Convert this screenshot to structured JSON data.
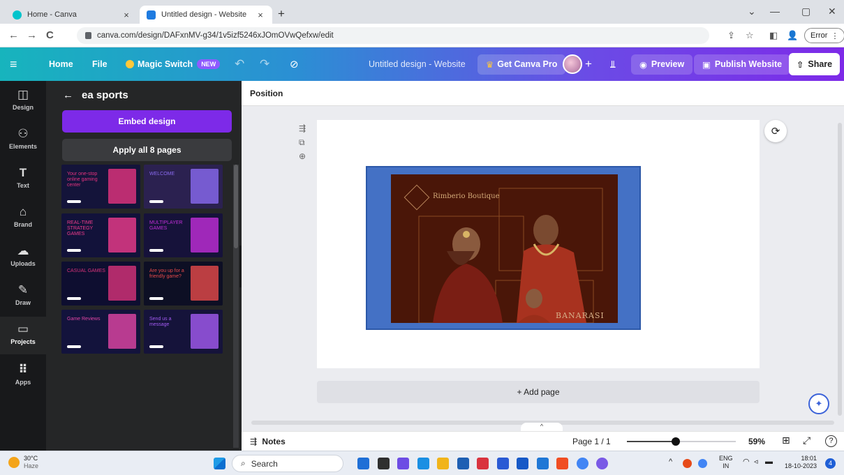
{
  "browser": {
    "tabs": [
      {
        "title": "Home - Canva",
        "close": "×"
      },
      {
        "title": "Untitled design - Website",
        "close": "×"
      }
    ],
    "new_tab": "+",
    "window_controls": {
      "menu": "⌄",
      "minimize": "—",
      "restore": "▢",
      "close": "✕"
    },
    "nav": {
      "back": "←",
      "forward": "→",
      "reload": "C"
    },
    "url": "canva.com/design/DAFxnMV-g34/1v5izf5246xJOmOVwQefxw/edit",
    "addr_icons": {
      "share": "⇪",
      "star": "☆",
      "sidebar": "◧",
      "profile": "👤"
    },
    "error_label": "Error",
    "error_menu": "⋮"
  },
  "toolbar": {
    "menu_icon": "≡",
    "home": "Home",
    "file": "File",
    "magic_switch": "Magic Switch",
    "new_badge": "NEW",
    "undo": "↶",
    "redo": "↷",
    "saved_icon": "⊘",
    "doc_title": "Untitled design - Website",
    "get_pro": "Get Canva Pro",
    "crown": "♛",
    "plus": "+",
    "insights_icon": "⫫",
    "preview": "Preview",
    "preview_icon": "◉",
    "publish": "Publish Website",
    "publish_icon": "▣",
    "share": "Share",
    "share_icon": "⇧"
  },
  "rail": [
    {
      "label": "Design",
      "glyph": "◫"
    },
    {
      "label": "Elements",
      "glyph": "⚇"
    },
    {
      "label": "Text",
      "glyph": "T"
    },
    {
      "label": "Brand",
      "glyph": "⌂"
    },
    {
      "label": "Uploads",
      "glyph": "☁"
    },
    {
      "label": "Draw",
      "glyph": "✎"
    },
    {
      "label": "Projects",
      "glyph": "▭"
    },
    {
      "label": "Apps",
      "glyph": "⠿"
    }
  ],
  "panel": {
    "back": "←",
    "title": "ea sports",
    "embed_button": "Embed design",
    "apply_button": "Apply all 8 pages",
    "thumbs": [
      {
        "headline": "Your one-stop online gaming center",
        "bg": "#14143a",
        "accent": "#e5337f"
      },
      {
        "headline": "WELCOME",
        "bg": "#2b2150",
        "accent": "#8a6af0"
      },
      {
        "headline": "REAL-TIME STRATEGY GAMES",
        "bg": "#12123a",
        "accent": "#ef3c8c"
      },
      {
        "headline": "MULTIPLAYER GAMES",
        "bg": "#16123a",
        "accent": "#c22ed9"
      },
      {
        "headline": "CASUAL GAMES",
        "bg": "#0e0e30",
        "accent": "#d9337a"
      },
      {
        "headline": "Are you up for a friendly game?",
        "bg": "#0d0f24",
        "accent": "#e74a4a"
      },
      {
        "headline": "Game Reviews",
        "bg": "#13133c",
        "accent": "#e246a5"
      },
      {
        "headline": "Send us a message",
        "bg": "#15133a",
        "accent": "#a45bf3"
      }
    ]
  },
  "editor": {
    "position_label": "Position",
    "page_tools": [
      "⇶",
      "⧉",
      "⊕"
    ],
    "refresh_icon": "⟳",
    "design": {
      "brand": "Rimberio Boutique",
      "tagline": "BANARASI"
    },
    "add_page": "+ Add page",
    "magic_icon": "✦",
    "collapse_icon": "‹",
    "expand_caret": "^"
  },
  "footer": {
    "notes_icon": "⇶",
    "notes": "Notes",
    "page_indicator": "Page 1 / 1",
    "zoom": "59%",
    "zoom_fraction": 0.59,
    "grid_icon": "⊞",
    "fullscreen_icon": "⤢",
    "help_icon": "?"
  },
  "taskbar": {
    "weather_temp": "30°C",
    "weather_cond": "Haze",
    "search": "Search",
    "search_icon": "⌕",
    "tray_up": "^",
    "lang_top": "ENG",
    "lang_bottom": "IN",
    "time": "18:01",
    "date": "18-10-2023",
    "badge": "4",
    "app_colors": [
      "#1f6fd6",
      "#2f2f2f",
      "#6d4ce4",
      "#1a8fe3",
      "#f1b41a",
      "#1e5fb3",
      "#d9333f",
      "#2a5ad4",
      "#1659c7",
      "#1f77d6",
      "#f04e23",
      "#4285f4",
      "#7a5ae6"
    ]
  }
}
